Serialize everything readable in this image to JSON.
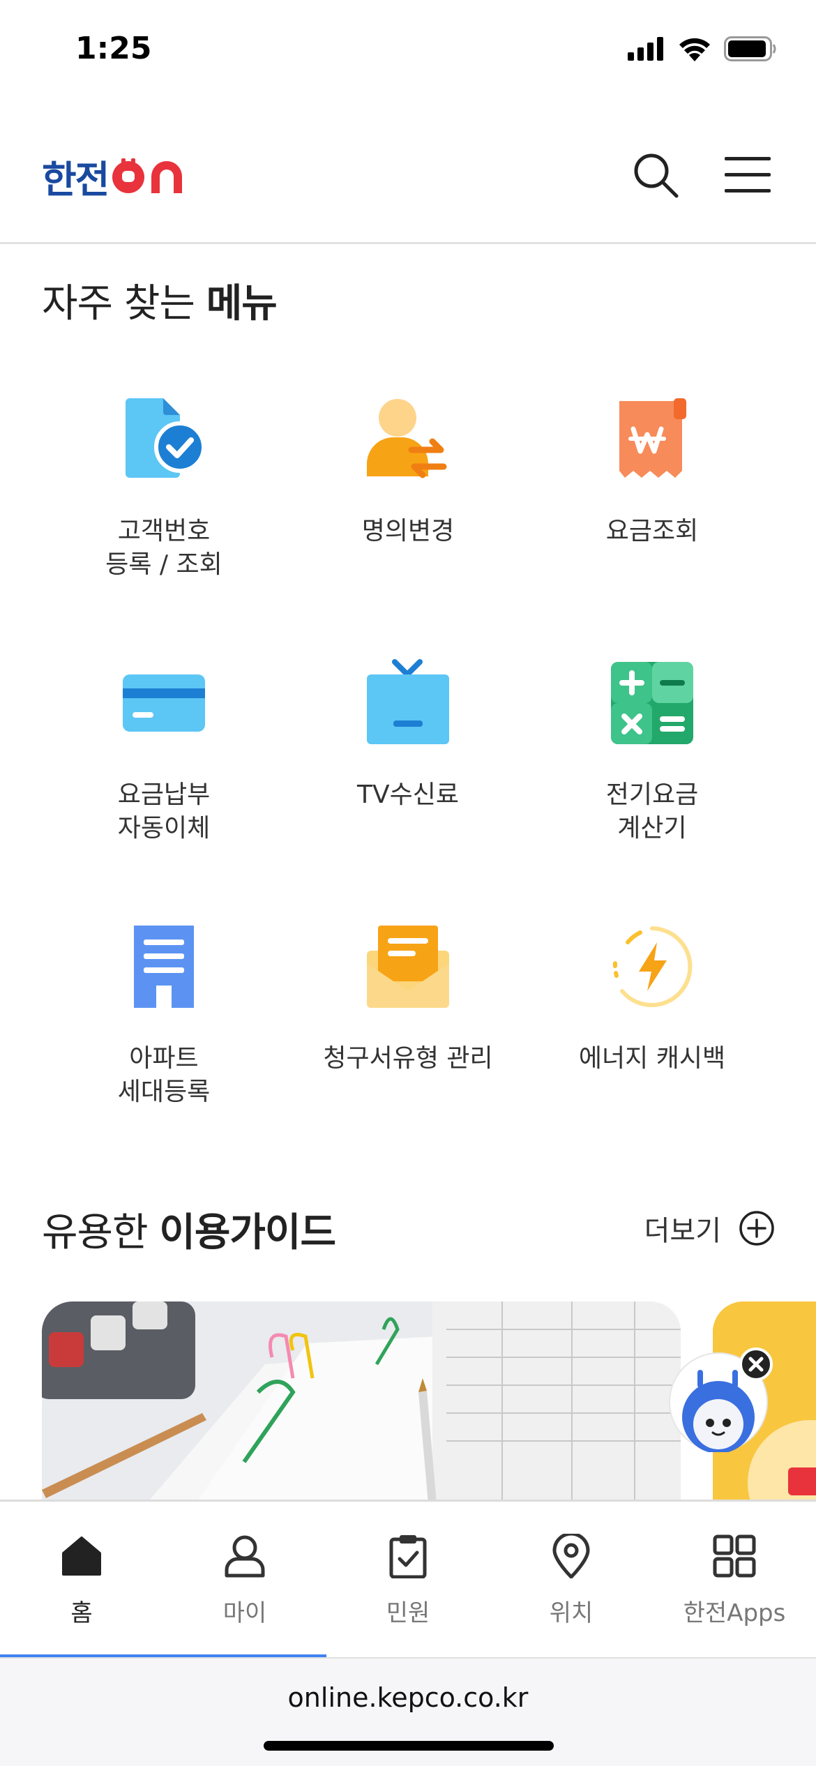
{
  "status_bar": {
    "time": "1:25",
    "icons": [
      "signal-icon",
      "wifi-icon",
      "battery-icon"
    ]
  },
  "header": {
    "logo_text": "한전",
    "logo_on": "on",
    "search_icon": "search-icon",
    "menu_icon": "hamburger-menu-icon"
  },
  "frequent_menu": {
    "title_regular": "자주 찾는",
    "title_bold": "메뉴",
    "items": [
      {
        "label": "고객번호\n등록 / 조회",
        "icon": "customer-number-icon"
      },
      {
        "label": "명의변경",
        "icon": "name-change-icon"
      },
      {
        "label": "요금조회",
        "icon": "bill-inquiry-icon"
      },
      {
        "label": "요금납부\n자동이체",
        "icon": "card-payment-icon"
      },
      {
        "label": "TV수신료",
        "icon": "tv-icon"
      },
      {
        "label": "전기요금\n계산기",
        "icon": "calculator-icon"
      },
      {
        "label": "아파트\n세대등록",
        "icon": "apartment-icon"
      },
      {
        "label": "청구서유형 관리",
        "icon": "bill-envelope-icon"
      },
      {
        "label": "에너지 캐시백",
        "icon": "energy-cashback-icon"
      }
    ]
  },
  "guide": {
    "title_regular": "유용한",
    "title_bold": "이용가이드",
    "more_label": "더보기"
  },
  "tabs": [
    {
      "label": "홈",
      "icon": "home-icon",
      "active": true
    },
    {
      "label": "마이",
      "icon": "user-icon",
      "active": false
    },
    {
      "label": "민원",
      "icon": "clipboard-check-icon",
      "active": false
    },
    {
      "label": "위치",
      "icon": "location-pin-icon",
      "active": false
    },
    {
      "label": "한전Apps",
      "icon": "apps-grid-icon",
      "active": false
    }
  ],
  "url_bar": {
    "url": "online.kepco.co.kr"
  },
  "colors": {
    "accent": "#3e82f0",
    "logo_blue": "#1a4aa0",
    "logo_red": "#e8333c"
  }
}
